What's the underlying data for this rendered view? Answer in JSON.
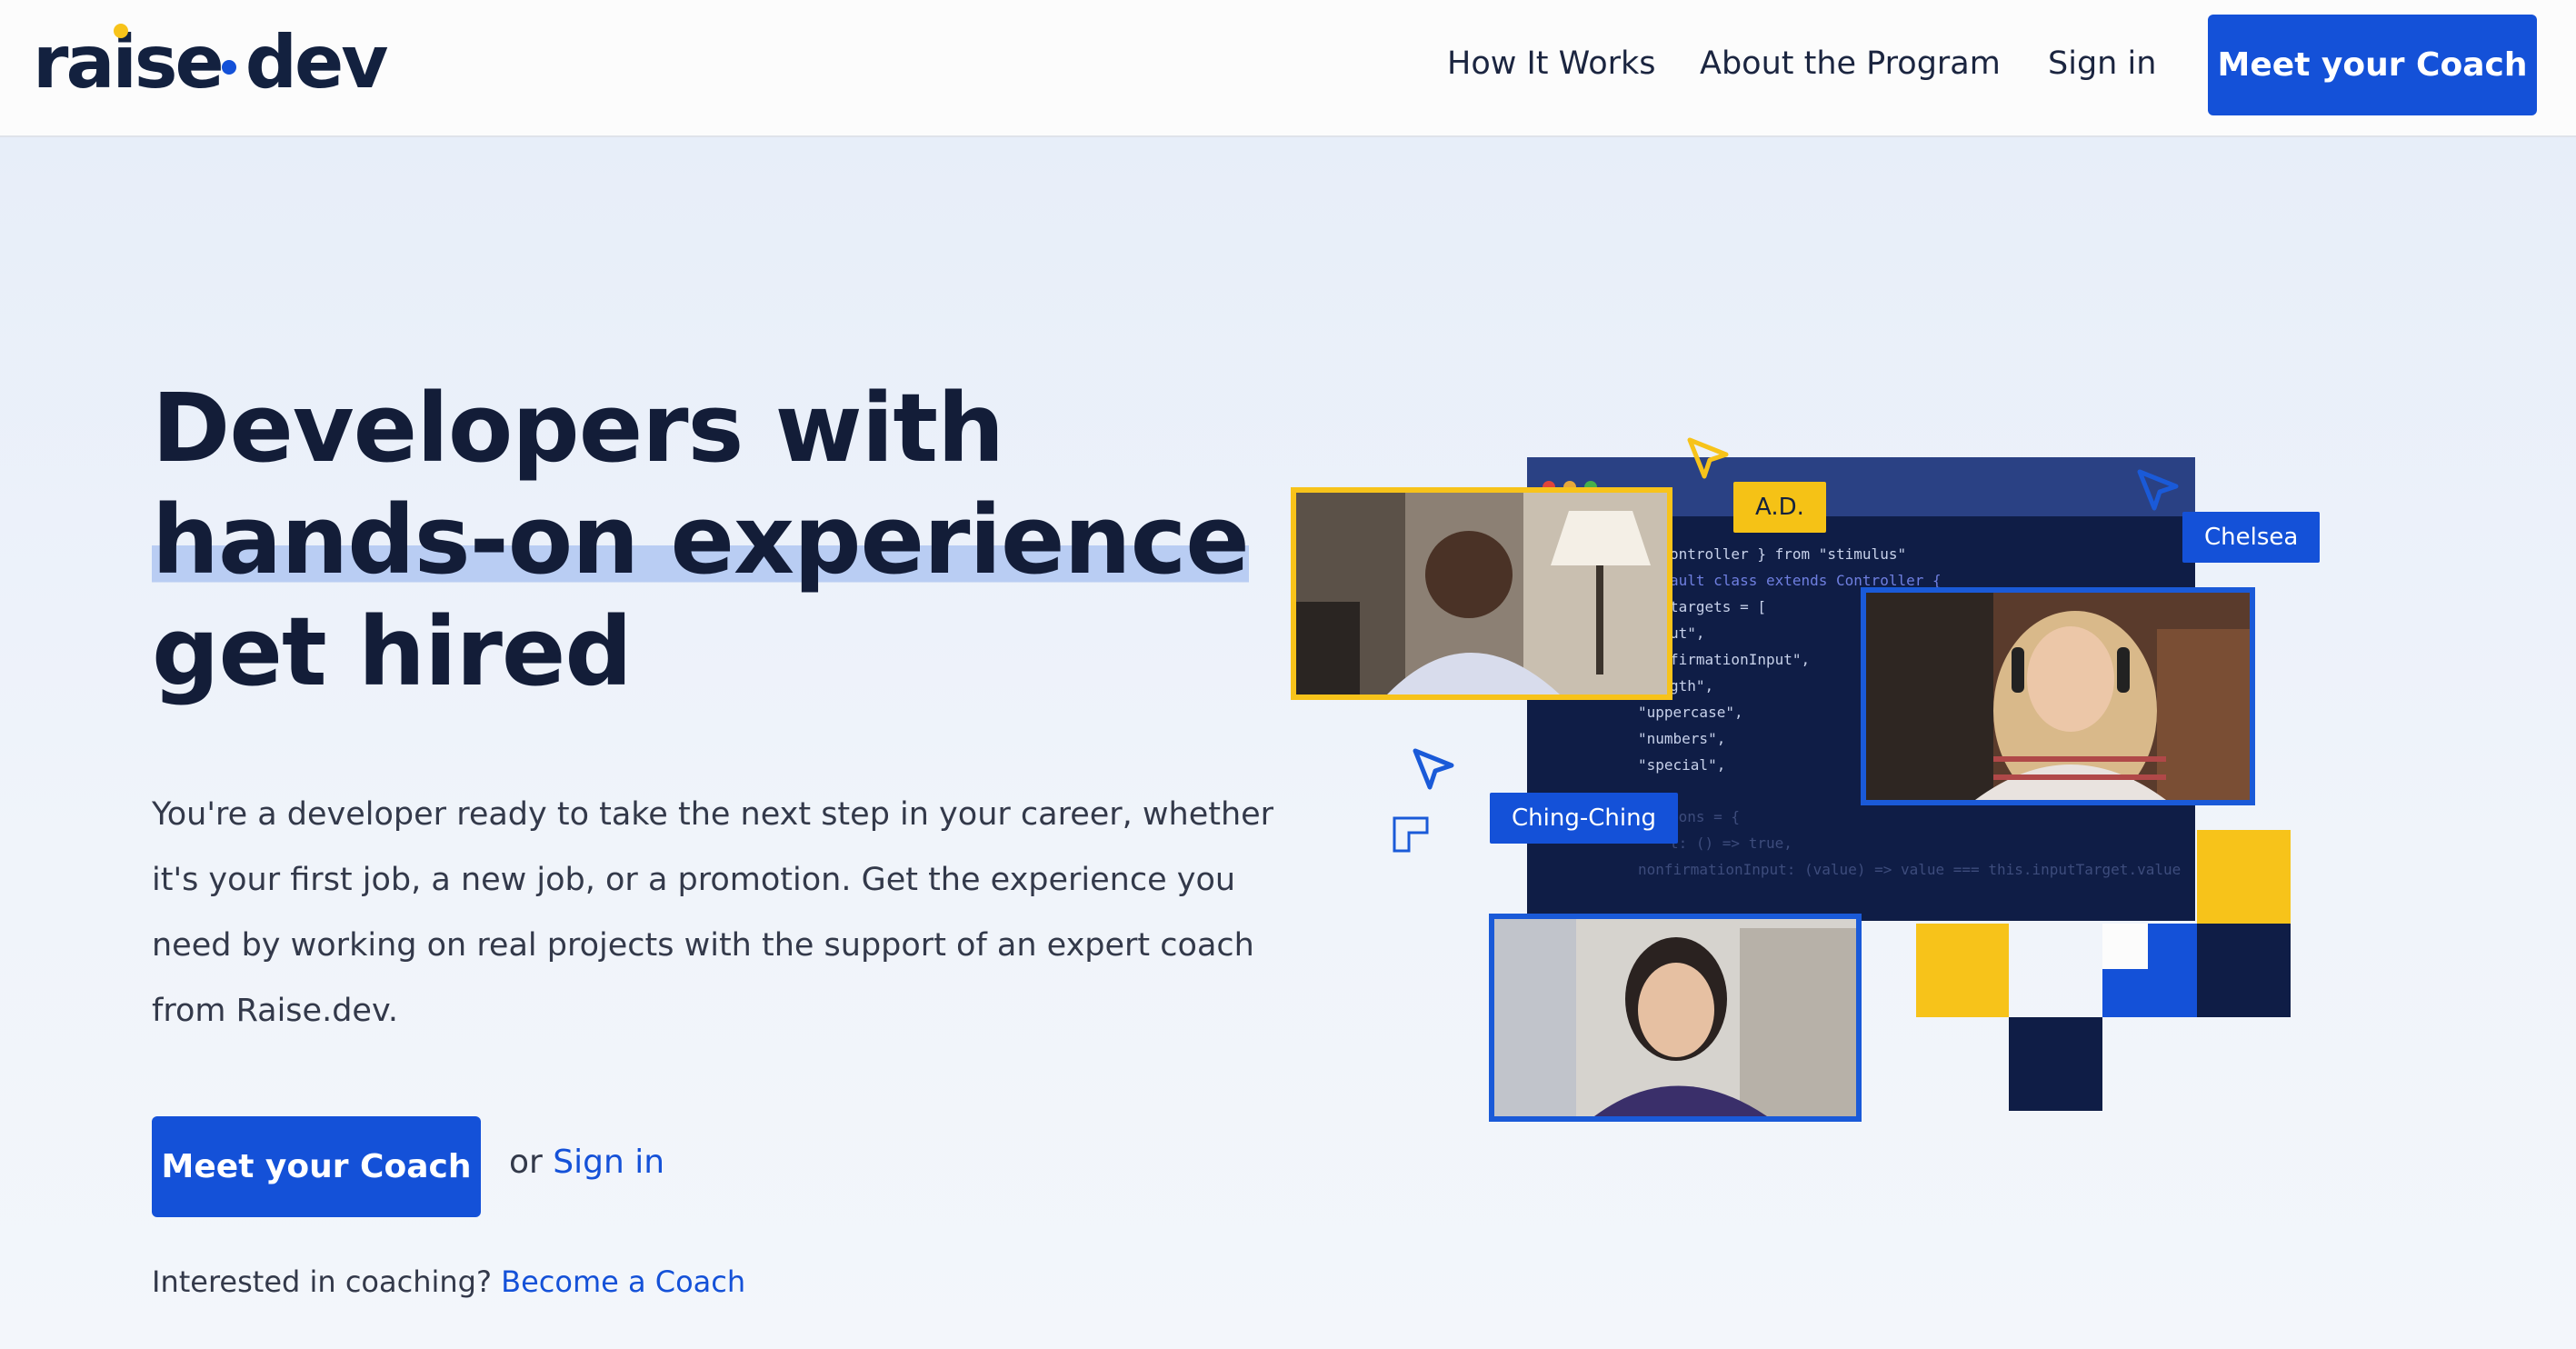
{
  "brand": {
    "name": "raise.dev",
    "logo_left": "raise",
    "logo_right": "dev"
  },
  "nav": {
    "items": [
      {
        "label": "How It Works"
      },
      {
        "label": "About the Program"
      },
      {
        "label": "Sign in"
      }
    ],
    "cta_label": "Meet your Coach"
  },
  "hero": {
    "headline": [
      "Developers with",
      "hands-on experience",
      "get hired"
    ],
    "body": "You're a developer ready to take the next step in your career, whether it's your first job, a new job, or a promotion. Get the experience you need by working on real projects with the support of an expert coach from Raise.dev.",
    "cta_label": "Meet your Coach",
    "or_text": "or",
    "signin_label": "Sign in",
    "coach_prompt": "Interested in coaching?",
    "become_coach_label": "Become a Coach"
  },
  "illustration": {
    "name_tags": [
      "A.D.",
      "Chelsea",
      "Ching-Ching"
    ],
    "code_lines": [
      "ontroller } from \"stimulus\"",
      "ault class extends Controller {",
      "targets = [",
      "ut\",",
      "firmationInput\",",
      "gth\",",
      "\"uppercase\",",
      "\"numbers\",",
      "\"special\",",
      "ions = {",
      "t: () => true,",
      "nonfirmationInput: (value) => value === this.inputTarget.value"
    ]
  },
  "colors": {
    "primary": "#1451d8",
    "accent_yellow": "#f7c31a",
    "navy": "#13213f"
  }
}
